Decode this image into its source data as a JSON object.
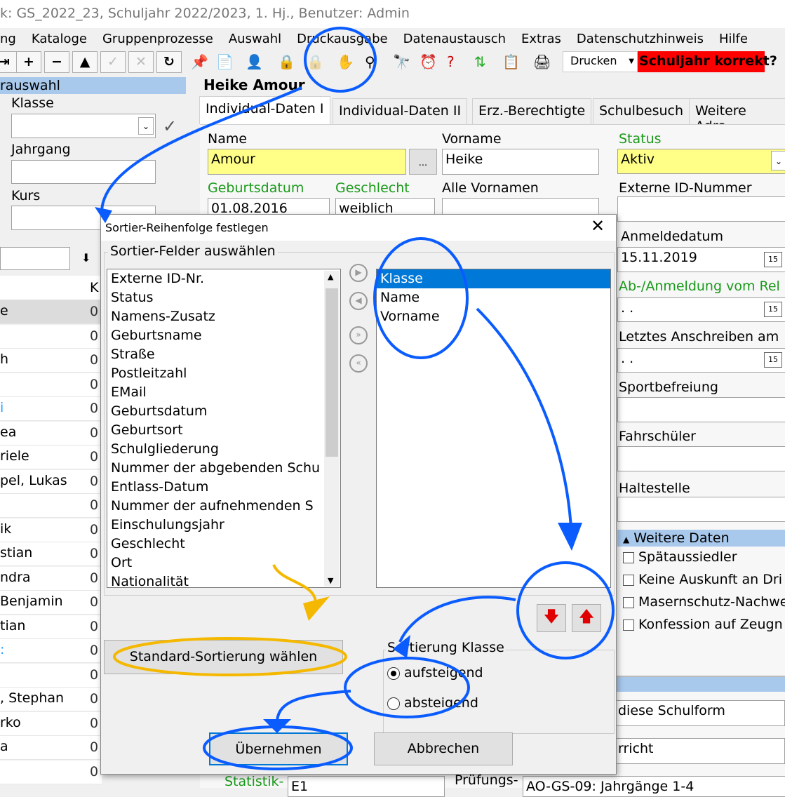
{
  "window": {
    "title": "k: GS_2022_23, Schuljahr 2022/2023, 1. Hj., Benutzer: Admin"
  },
  "menu": [
    "ng",
    "Kataloge",
    "Gruppenprozesse",
    "Auswahl",
    "Druckausgabe",
    "Datenaustausch",
    "Extras",
    "Datenschutzhinweis",
    "Hilfe"
  ],
  "toolbar": {
    "nav_buttons": [
      "⇥",
      "+",
      "−",
      "▲",
      "✓",
      "✕",
      "↻"
    ],
    "print_select": "Drucken",
    "warning": "Schuljahr korrekt?",
    "warning_color": "#ff0000"
  },
  "left": {
    "header": "rauswahl",
    "klasse_label": "Klasse",
    "jahrgang_label": "Jahrgang",
    "kurs_label": "Kurs",
    "col_k": "K",
    "rows": [
      {
        "n": "e",
        "k": "0"
      },
      {
        "n": "",
        "k": "0"
      },
      {
        "n": "h",
        "k": "0"
      },
      {
        "n": "",
        "k": "0"
      },
      {
        "n": "i",
        "k": "0"
      },
      {
        "n": "ea",
        "k": "0"
      },
      {
        "n": "riele",
        "k": "0"
      },
      {
        "n": "pel, Lukas",
        "k": "0"
      },
      {
        "n": "",
        "k": "0"
      },
      {
        "n": "ik",
        "k": "0"
      },
      {
        "n": "stian",
        "k": "0"
      },
      {
        "n": "ndra",
        "k": "0"
      },
      {
        "n": "Benjamin",
        "k": "0"
      },
      {
        "n": "tian",
        "k": "0"
      },
      {
        "n": ":",
        "k": "0"
      },
      {
        "n": "",
        "k": "0"
      },
      {
        "n": ", Stephan",
        "k": "0"
      },
      {
        "n": "rko",
        "k": "0"
      },
      {
        "n": "a",
        "k": "0"
      },
      {
        "n": "",
        "k": "0"
      }
    ]
  },
  "student": {
    "name_heading": "Heike Amour"
  },
  "tabs": [
    "Individual-Daten I",
    "Individual-Daten II",
    "Erz.-Berechtigte",
    "Schulbesuch",
    "Weitere Adre"
  ],
  "form": {
    "name_label": "Name",
    "name": "Amour",
    "vorname_label": "Vorname",
    "vorname": "Heike",
    "geburtsdatum_label": "Geburtsdatum",
    "geburtsdatum": "01.08.2016",
    "geschlecht_label": "Geschlecht",
    "geschlecht": "weiblich",
    "alle_vornamen_label": "Alle Vornamen",
    "dots": "...",
    "status_label": "Status",
    "status": "Aktiv",
    "externe_id_label": "Externe ID-Nummer",
    "anmeldedatum_label": "Anmeldedatum",
    "anmeldedatum": "15.11.2019",
    "abanmeldung_label": "Ab-/Anmeldung vom Rel",
    "empty_date": " .  .",
    "letztes_label": "Letztes Anschreiben am",
    "sport_label": "Sportbefreiung",
    "fahr_label": "Fahrschüler",
    "halte_label": "Haltestelle",
    "weitere_label": "Weitere Daten",
    "checks": [
      "Spätaussiedler",
      "Keine Auskunft an Dri",
      "Masernschutz-Nachwe",
      "Konfession auf Zeugn"
    ],
    "schulform": "diese Schulform",
    "unterricht": "rricht",
    "statistik_label": "Statistik-",
    "statistik": "E1",
    "pruefung_label": "Prüfungs-",
    "pruefung": "AO-GS-09: Jahrgänge 1-4"
  },
  "dialog": {
    "title": "Sortier-Reihenfolge festlegen",
    "group_label": "Sortier-Felder auswählen",
    "available": [
      "Externe ID-Nr.",
      "Status",
      "Namens-Zusatz",
      "Geburtsname",
      "Straße",
      "Postleitzahl",
      "EMail",
      "Geburtsdatum",
      "Geburtsort",
      "Schulgliederung",
      "Nummer der abgebenden Schu",
      "Entlass-Datum",
      "Nummer der aufnehmenden S",
      "Einschulungsjahr",
      "Geschlecht",
      "Ort",
      "Nationalität"
    ],
    "selected": [
      "Klasse",
      "Name",
      "Vorname"
    ],
    "selected_index": 0,
    "standard_button": "Standard-Sortierung wählen",
    "order_group": "Sortierung Klasse",
    "asc": "aufsteigend",
    "desc": "absteigend",
    "asc_checked": true,
    "ok": "Übernehmen",
    "cancel": "Abbrechen"
  },
  "annotation_colors": {
    "blue": "#0a5cff",
    "yellow": "#f5b800"
  }
}
